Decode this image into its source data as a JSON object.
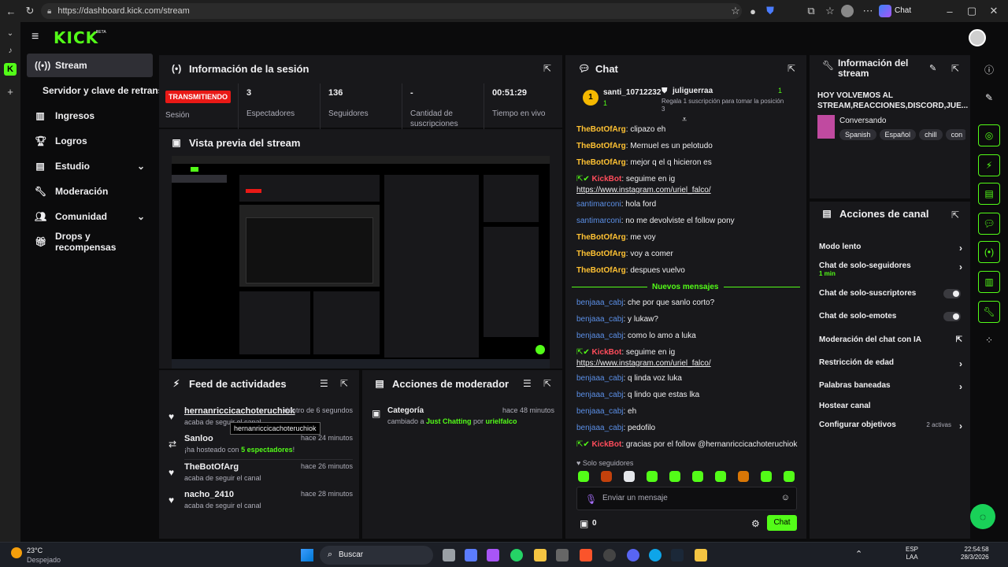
{
  "browser": {
    "url": "https://dashboard.kick.com/stream",
    "chat_label": "Chat"
  },
  "app": {
    "logo": "KICK",
    "logo_sup": "BETA"
  },
  "sidebar": {
    "items": [
      {
        "label": "Stream",
        "icon": "broadcast-icon",
        "active": true
      },
      {
        "label": "Servidor y clave de retransmisión",
        "icon": ""
      },
      {
        "label": "Ingresos",
        "icon": "chart-icon"
      },
      {
        "label": "Logros",
        "icon": "trophy-icon"
      },
      {
        "label": "Estudio",
        "icon": "studio-icon",
        "chevron": true
      },
      {
        "label": "Moderación",
        "icon": "wrench-icon"
      },
      {
        "label": "Comunidad",
        "icon": "people-icon",
        "chevron": true
      },
      {
        "label": "Drops y recompensas",
        "icon": "gift-icon"
      }
    ]
  },
  "session": {
    "title": "Información de la sesión",
    "status": "TRANSMITIENDO",
    "status_label": "Sesión",
    "stats": [
      {
        "value": "3",
        "label": "Espectadores"
      },
      {
        "value": "136",
        "label": "Seguidores"
      },
      {
        "value": "-",
        "label": "Cantidad de suscripciones"
      },
      {
        "value": "00:51:29",
        "label": "Tiempo en vivo"
      }
    ]
  },
  "preview": {
    "title": "Vista previa del stream"
  },
  "feed": {
    "title": "Feed de actividades",
    "tooltip": "hernanriccicachoteruchiok",
    "items": [
      {
        "name": "hernanriccicachoteruchiok",
        "when": "dentro de 6 segundos",
        "sub": "acaba de seguir el canal"
      },
      {
        "name": "Sanloo",
        "when": "hace 24 minutos",
        "sub_a": "¡ha hosteado con ",
        "sub_b": "5 espectadores",
        "sub_c": "!"
      },
      {
        "name": "TheBotOfArg",
        "when": "hace 26 minutos",
        "sub": "acaba de seguir el canal"
      },
      {
        "name": "nacho_2410",
        "when": "hace 28 minutos",
        "sub": "acaba de seguir el canal"
      }
    ]
  },
  "mod": {
    "title": "Acciones de moderador",
    "item_title": "Categoría",
    "when": "hace 48 minutos",
    "sub_a": "cambiado a ",
    "sub_b": "Just Chatting",
    "sub_c": " por ",
    "sub_d": "urielfalco"
  },
  "chat": {
    "title": "Chat",
    "pinned": {
      "user1": "santi_10712232",
      "count1": "1",
      "user2": "juliguerraa",
      "count2": "1",
      "gift": "Regala 1 suscripción para tomar la posición 3"
    },
    "new_messages": "Nuevos mensajes",
    "lines": [
      {
        "user": "TheBotOfArg",
        "cls": "u-bot",
        "text": ": clipazo eh"
      },
      {
        "user": "TheBotOfArg",
        "cls": "u-bot",
        "text": ": Mernuel es un pelotudo"
      },
      {
        "user": "TheBotOfArg",
        "cls": "u-bot",
        "text": ": mejor q el q hicieron es"
      },
      {
        "user": "KickBot",
        "cls": "u-kick",
        "text": ": seguime en ig",
        "link": "https://www.instagram.com/uriel_falco/"
      },
      {
        "user": "santimarconi",
        "cls": "u-blue",
        "text": ": hola ford"
      },
      {
        "user": "santimarconi",
        "cls": "u-blue",
        "text": ": no me devolviste el follow pony"
      },
      {
        "user": "TheBotOfArg",
        "cls": "u-bot",
        "text": ": me voy"
      },
      {
        "user": "TheBotOfArg",
        "cls": "u-bot",
        "text": ": voy a comer"
      },
      {
        "user": "TheBotOfArg",
        "cls": "u-bot",
        "text": ": despues vuelvo"
      },
      {
        "user": "benjaaa_cabj",
        "cls": "u-blue",
        "text": ": che por que sanlo corto?"
      },
      {
        "user": "benjaaa_cabj",
        "cls": "u-blue",
        "text": ": y lukaw?"
      },
      {
        "user": "benjaaa_cabj",
        "cls": "u-blue",
        "text": ": como lo amo a luka"
      },
      {
        "user": "KickBot",
        "cls": "u-kick",
        "text": ": seguime en ig",
        "link": "https://www.instagram.com/uriel_falco/"
      },
      {
        "user": "benjaaa_cabj",
        "cls": "u-blue",
        "text": ": q linda voz luka"
      },
      {
        "user": "benjaaa_cabj",
        "cls": "u-blue",
        "text": ": q lindo que estas lka"
      },
      {
        "user": "benjaaa_cabj",
        "cls": "u-blue",
        "text": ": eh"
      },
      {
        "user": "benjaaa_cabj",
        "cls": "u-blue",
        "text": ": pedofilo"
      },
      {
        "user": "KickBot",
        "cls": "u-kick",
        "text": ": gracias por el follow @hernanriccicachoteruchiok"
      }
    ],
    "followers_only": "Solo seguidores",
    "placeholder": "Enviar un mensaje",
    "points": "0",
    "send": "Chat"
  },
  "info": {
    "title": "Información del stream",
    "stream_title": "HOY VOLVEMOS AL STREAM,REACCIONES,DISCORD,JUE...",
    "category": "Conversando",
    "tags": [
      "Spanish",
      "Español",
      "chill",
      "con"
    ]
  },
  "actions": {
    "title": "Acciones de canal",
    "items": [
      {
        "label": "Modo lento",
        "type": "arrow"
      },
      {
        "label": "Chat de solo-seguidores",
        "sub": "1 min",
        "type": "arrow"
      },
      {
        "label": "Chat de solo-suscriptores",
        "type": "toggle"
      },
      {
        "label": "Chat de solo-emotes",
        "type": "toggle"
      },
      {
        "label": "Moderación del chat con IA",
        "type": "ext"
      },
      {
        "label": "Restricción de edad",
        "type": "arrow"
      },
      {
        "label": "Palabras baneadas",
        "type": "arrow"
      },
      {
        "label": "Hostear canal",
        "type": "none"
      },
      {
        "label": "Configurar objetivos",
        "type": "arrow",
        "badge": "2 activas"
      }
    ]
  },
  "taskbar": {
    "temp": "23°C",
    "weather": "Despejado",
    "search": "Buscar",
    "lang1": "ESP",
    "lang2": "LAA",
    "time": "22:54:58",
    "date": "28/3/2026"
  },
  "colors": {
    "accent": "#53fc18",
    "live": "#e91916",
    "panel": "#18181b"
  }
}
